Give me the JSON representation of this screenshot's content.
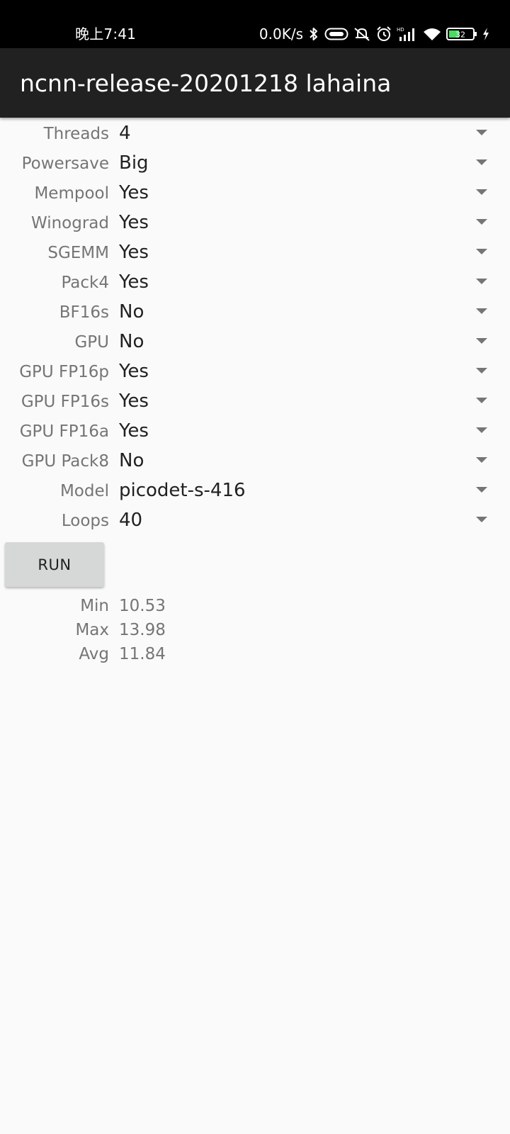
{
  "status_bar": {
    "time": "晚上7:41",
    "net_speed": "0.0K/s",
    "signal_label": "HD",
    "battery_level": "32",
    "icons": [
      "bluetooth-icon",
      "vibrate-icon",
      "alarm-muted-icon",
      "alarm-clock-icon",
      "signal-icon",
      "wifi-icon",
      "battery-icon",
      "charging-icon"
    ]
  },
  "app_bar": {
    "title": "ncnn-release-20201218 lahaina"
  },
  "settings": [
    {
      "label": "Threads",
      "value": "4"
    },
    {
      "label": "Powersave",
      "value": "Big"
    },
    {
      "label": "Mempool",
      "value": "Yes"
    },
    {
      "label": "Winograd",
      "value": "Yes"
    },
    {
      "label": "SGEMM",
      "value": "Yes"
    },
    {
      "label": "Pack4",
      "value": "Yes"
    },
    {
      "label": "BF16s",
      "value": "No"
    },
    {
      "label": "GPU",
      "value": "No"
    },
    {
      "label": "GPU FP16p",
      "value": "Yes"
    },
    {
      "label": "GPU FP16s",
      "value": "Yes"
    },
    {
      "label": "GPU FP16a",
      "value": "Yes"
    },
    {
      "label": "GPU Pack8",
      "value": "No"
    },
    {
      "label": "Model",
      "value": "picodet-s-416"
    },
    {
      "label": "Loops",
      "value": "40"
    }
  ],
  "run_button": {
    "label": "RUN"
  },
  "results": [
    {
      "label": "Min",
      "value": "10.53"
    },
    {
      "label": "Max",
      "value": "13.98"
    },
    {
      "label": "Avg",
      "value": "11.84"
    }
  ]
}
